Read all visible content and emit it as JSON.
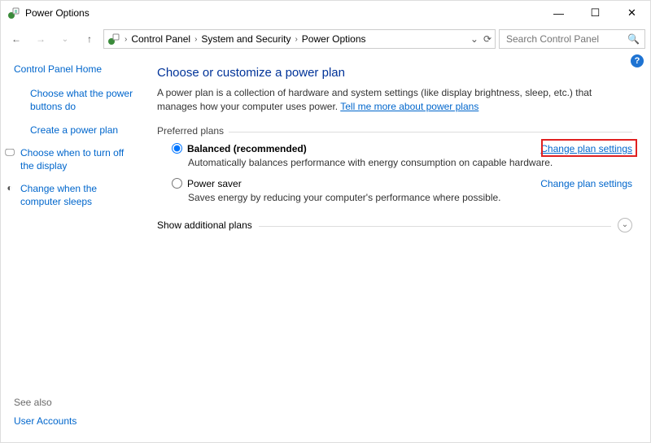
{
  "window": {
    "title": "Power Options",
    "min": "—",
    "max": "☐",
    "close": "✕"
  },
  "nav": {
    "back_icon": "←",
    "forward_icon": "→",
    "up_icon": "↑"
  },
  "address": {
    "crumbs": [
      "Control Panel",
      "System and Security",
      "Power Options"
    ],
    "dropdown_icon": "⌄",
    "refresh_icon": "⟳"
  },
  "search": {
    "placeholder": "Search Control Panel",
    "icon": "🔍"
  },
  "sidebar": {
    "home": "Control Panel Home",
    "items": [
      {
        "icon": "",
        "label": "Choose what the power buttons do"
      },
      {
        "icon": "",
        "label": "Create a power plan"
      },
      {
        "icon": "🖵",
        "label": "Choose when to turn off the display"
      },
      {
        "icon": "◐",
        "label": "Change when the computer sleeps"
      }
    ],
    "see_also_label": "See also",
    "see_also_item": "User Accounts"
  },
  "main": {
    "help_icon": "?",
    "heading": "Choose or customize a power plan",
    "description": "A power plan is a collection of hardware and system settings (like display brightness, sleep, etc.) that manages how your computer uses power. ",
    "learn_link": "Tell me more about power plans",
    "preferred_plans_label": "Preferred plans",
    "plans": [
      {
        "name": "Balanced (recommended)",
        "selected": true,
        "sub": "Automatically balances performance with energy consumption on capable hardware.",
        "change": "Change plan settings"
      },
      {
        "name": "Power saver",
        "selected": false,
        "sub": "Saves energy by reducing your computer's performance where possible.",
        "change": "Change plan settings"
      }
    ],
    "show_additional": "Show additional plans",
    "expand_icon": "⌄"
  }
}
